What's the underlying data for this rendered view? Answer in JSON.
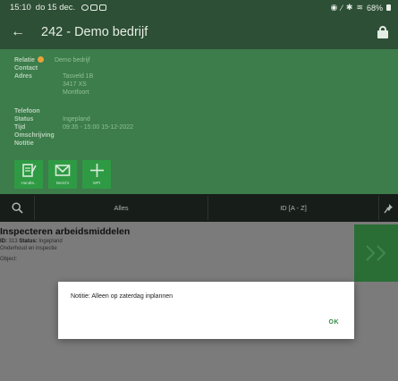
{
  "status_bar": {
    "time": "15:10",
    "date": "do 15 dec.",
    "battery": "68%"
  },
  "header": {
    "title": "242 - Demo bedrijf"
  },
  "details": {
    "rows": [
      {
        "label": "Relatie",
        "value": "Demo bedrijf"
      },
      {
        "label": "Contact",
        "value": ""
      },
      {
        "label": "Adres",
        "value": "Tasveld 1B"
      },
      {
        "label": "",
        "value": "3417 XS"
      },
      {
        "label": "",
        "value": "Montfoort"
      },
      {
        "label": "Telefoon",
        "value": ""
      },
      {
        "label": "Status",
        "value": "Ingepland"
      },
      {
        "label": "Tijd",
        "value": "09:35 - 15:00 15-12-2022"
      },
      {
        "label": "Omschrijving",
        "value": ""
      },
      {
        "label": "Notitie",
        "value": ""
      }
    ],
    "relation_status_color": "#e8a23a"
  },
  "actions": [
    {
      "icon": "sign-document-icon",
      "label": "Handte.."
    },
    {
      "icon": "mail-icon",
      "label": "Bericht"
    },
    {
      "icon": "plus-icon",
      "label": "WPI"
    }
  ],
  "filter": {
    "all_label": "Alles",
    "sort_label": "ID [A - Z]"
  },
  "list_item": {
    "title": "Inspecteren arbeidsmiddelen",
    "id_label": "ID:",
    "id_value": "313",
    "status_label": "Status:",
    "status_value": "Ingepland",
    "type": "Onderhoud en inspectie",
    "object_label": "Object:"
  },
  "dialog": {
    "message": "Notitie: Alleen op zaterdag inplannen",
    "ok_label": "OK"
  },
  "colors": {
    "primary_dark": "#2d4f35",
    "primary": "#3d7c4b",
    "accent": "#2f9a44",
    "overlay": "#7b7b7b"
  }
}
